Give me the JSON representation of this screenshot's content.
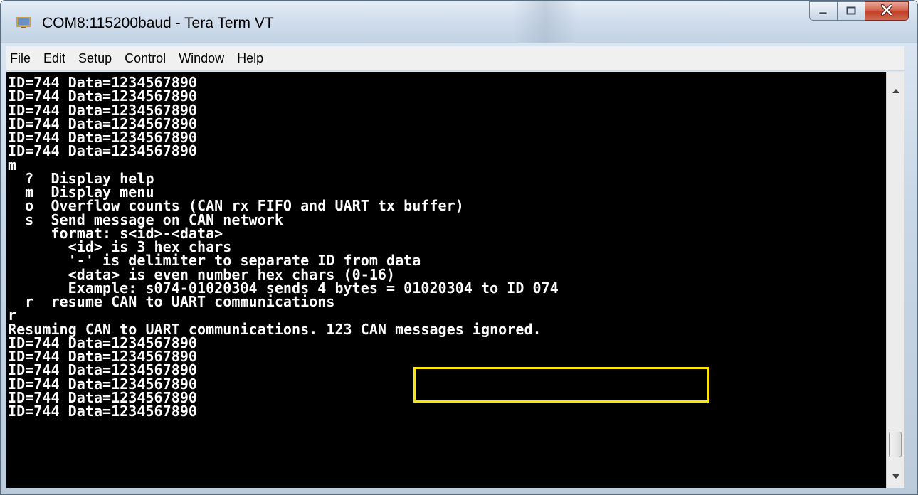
{
  "window": {
    "title": "COM8:115200baud - Tera Term VT"
  },
  "menu": [
    "File",
    "Edit",
    "Setup",
    "Control",
    "Window",
    "Help"
  ],
  "terminal": {
    "lines": [
      "ID=744 Data=1234567890",
      "ID=744 Data=1234567890",
      "ID=744 Data=1234567890",
      "ID=744 Data=1234567890",
      "ID=744 Data=1234567890",
      "ID=744 Data=1234567890",
      "m",
      "  ?  Display help",
      "  m  Display menu",
      "  o  Overflow counts (CAN rx FIFO and UART tx buffer)",
      "  s  Send message on CAN network",
      "     format: s<id>-<data>",
      "       <id> is 3 hex chars",
      "       '-' is delimiter to separate ID from data",
      "       <data> is even number hex chars (0-16)",
      "       Example: s074-01020304 sends 4 bytes = 01020304 to ID 074",
      "  r  resume CAN to UART communications",
      "r",
      "Resuming CAN to UART communications. 123 CAN messages ignored.",
      "ID=744 Data=1234567890",
      "ID=744 Data=1234567890",
      "ID=744 Data=1234567890",
      "ID=744 Data=1234567890",
      "ID=744 Data=1234567890",
      "ID=744 Data=1234567890"
    ],
    "highlight_text": "123 CAN messages ignored.",
    "text_color": "#ffffff",
    "background_color": "#000000",
    "highlight_color": "#ffe600"
  },
  "icons": {
    "app": "tera-term-icon",
    "minimize": "minimize-icon",
    "maximize": "maximize-icon",
    "close": "close-icon",
    "scroll_up": "scroll-up-arrow-icon",
    "scroll_down": "scroll-down-arrow-icon"
  }
}
